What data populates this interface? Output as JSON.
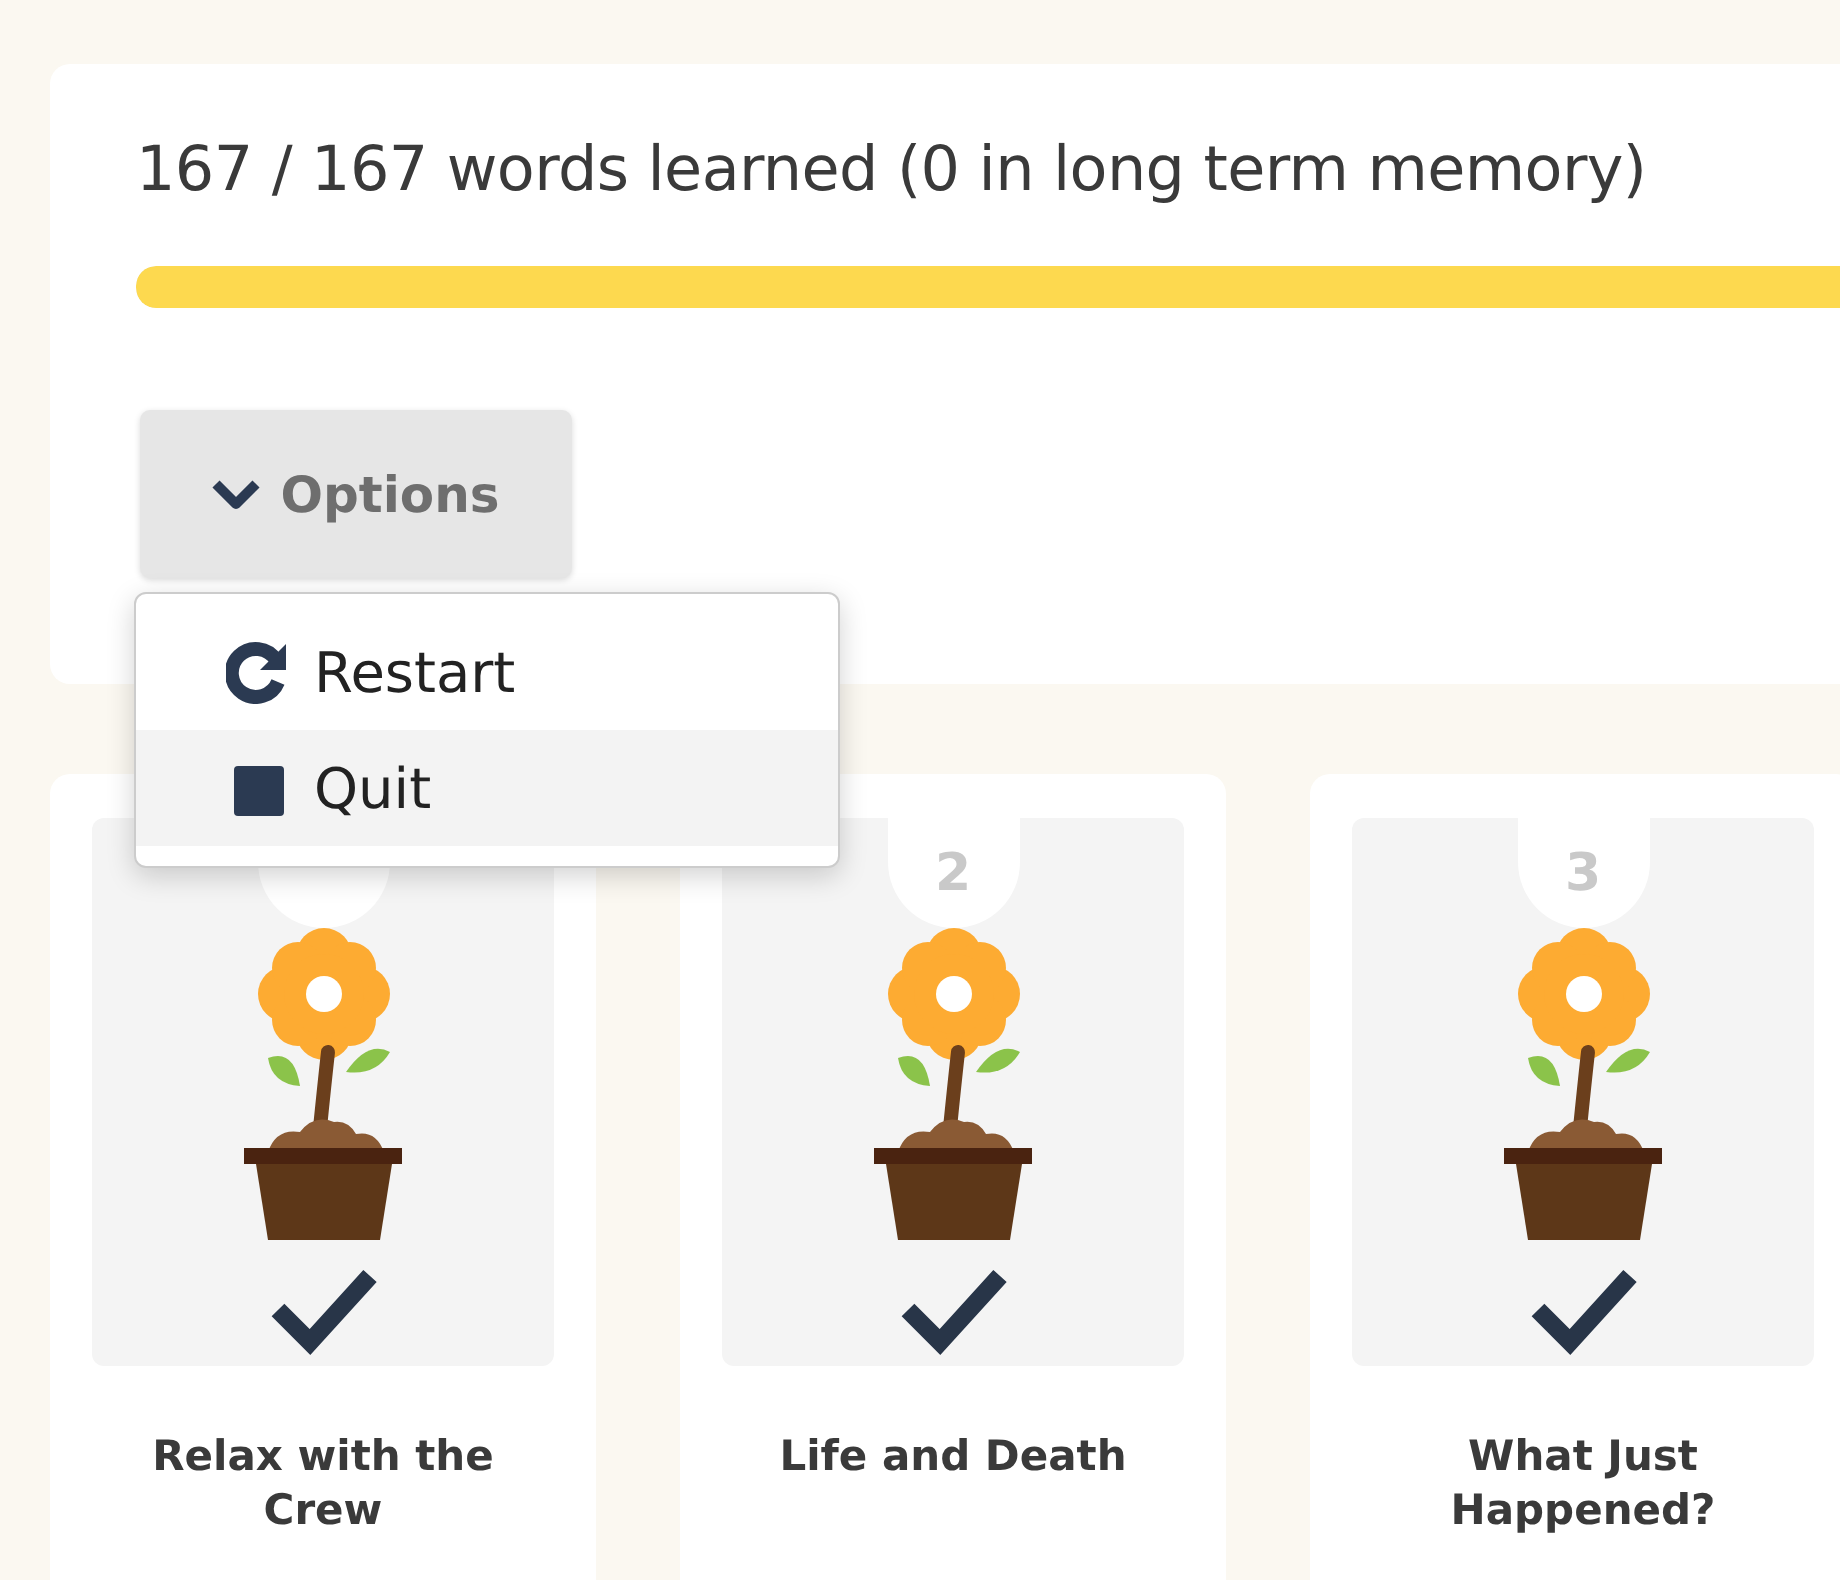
{
  "progress": {
    "title": "167 / 167 words learned (0 in long term memory)",
    "level": 1
  },
  "options_button": {
    "label": "Options"
  },
  "menu": {
    "items": [
      {
        "kind": "restart",
        "label": "Restart",
        "highlighted": false
      },
      {
        "kind": "quit",
        "label": "Quit",
        "highlighted": true
      }
    ]
  },
  "levels": [
    {
      "title": "Relax with the Crew",
      "learned": true
    },
    {
      "number": "2",
      "title": "Life and Death",
      "learned": true
    },
    {
      "number": "3",
      "title": "What Just Happened?",
      "learned": true
    }
  ]
}
